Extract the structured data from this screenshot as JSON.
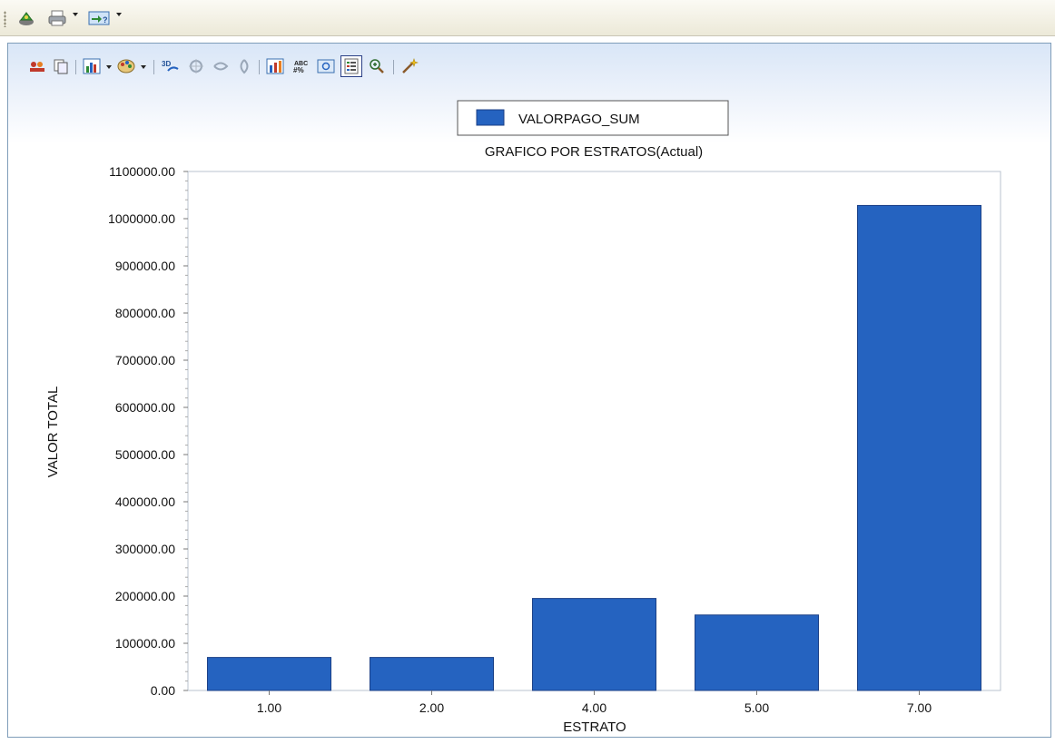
{
  "toolbar": {
    "items": [
      {
        "icon": "run-icon"
      },
      {
        "icon": "print-icon",
        "dropdown": true
      },
      {
        "icon": "export-icon",
        "dropdown": true
      }
    ]
  },
  "chart_toolbar": {
    "icons": [
      "switch-rows-columns-icon",
      "copy-icon",
      "chart-type-icon",
      "palette-icon",
      "3d-icon",
      "rotate-icon",
      "rotate-horizontal-icon",
      "rotate-vertical-icon",
      "data-table-icon",
      "data-labels-icon",
      "preview-icon",
      "legend-icon",
      "zoom-icon",
      "wizard-icon"
    ]
  },
  "colors": {
    "bar": "#2563c0",
    "bar_stroke": "#1b3f86",
    "plot_border": "#b9c3cf"
  },
  "chart_data": {
    "type": "bar",
    "title": "GRAFICO POR ESTRATOS(Actual)",
    "xlabel": "ESTRATO",
    "ylabel": "VALOR TOTAL",
    "categories": [
      "1.00",
      "2.00",
      "4.00",
      "5.00",
      "7.00"
    ],
    "series": [
      {
        "name": "VALORPAGO_SUM",
        "values": [
          70000,
          70000,
          195000,
          160000,
          1028000
        ]
      }
    ],
    "ylim": [
      0,
      1100000
    ],
    "y_ticks": [
      "0.00",
      "100000.00",
      "200000.00",
      "300000.00",
      "400000.00",
      "500000.00",
      "600000.00",
      "700000.00",
      "800000.00",
      "900000.00",
      "1000000.00",
      "1100000.00"
    ],
    "legend_position": "top-center",
    "grid": false
  }
}
